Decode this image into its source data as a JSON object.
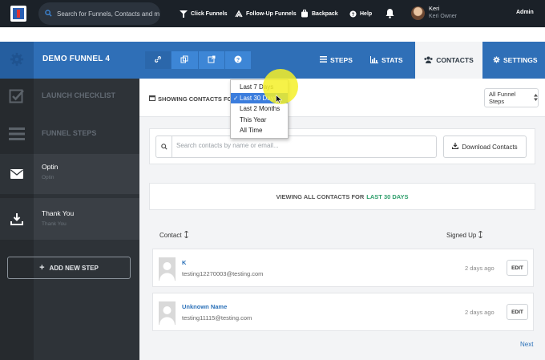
{
  "topnav": {
    "search_placeholder": "Search for Funnels, Contacts and more",
    "items": [
      {
        "label": "Click Funnels",
        "icon": "funnel-icon"
      },
      {
        "label": "Follow-Up Funnels",
        "icon": "follow-up-icon"
      },
      {
        "label": "Backpack",
        "icon": "backpack-icon"
      },
      {
        "label": "Help",
        "icon": "help-icon"
      }
    ],
    "notification_icon": "bell-icon",
    "user": {
      "name": "Keri",
      "role": "Keri  Owner"
    },
    "admin_label": "Admin"
  },
  "funnel": {
    "title": "DEMO FUNNEL 4",
    "tools": [
      "link-icon",
      "copy-icon",
      "external-link-icon",
      "help-icon"
    ],
    "tabs": [
      {
        "label": "STEPS",
        "icon": "list-icon"
      },
      {
        "label": "STATS",
        "icon": "bar-chart-icon"
      },
      {
        "label": "CONTACTS",
        "icon": "users-icon",
        "active": true
      },
      {
        "label": "SETTINGS",
        "icon": "gear-icon"
      }
    ]
  },
  "sidebar": {
    "launch_checklist": "LAUNCH CHECKLIST",
    "funnel_steps": "FUNNEL STEPS",
    "steps": [
      {
        "title": "Optin",
        "subtitle": "Optin",
        "icon": "envelope-icon"
      },
      {
        "title": "Thank You",
        "subtitle": "Thank You",
        "icon": "download-icon"
      }
    ],
    "add_step": "ADD NEW STEP"
  },
  "contacts": {
    "showing_label": "SHOWING CONTACTS FOR",
    "date_options": [
      "Last 7 Days",
      "Last 30 Days",
      "Last 2 Months",
      "This Year",
      "All Time"
    ],
    "selected_date": "Last 30 Days",
    "steps_filter": "All Funnel Steps",
    "search_placeholder": "Search contacts by name or email...",
    "download_label": "Download Contacts",
    "viewing_prefix": "VIEWING ALL CONTACTS FOR",
    "viewing_range": "LAST 30 DAYS",
    "col_contact": "Contact",
    "col_signed_up": "Signed Up",
    "rows": [
      {
        "name": "K",
        "email": "testing12270003@testing.com",
        "signed_up": "2 days ago",
        "action": "EDIT"
      },
      {
        "name": "Unknown Name",
        "email": "testing11115@testing.com",
        "signed_up": "2 days ago",
        "action": "EDIT"
      }
    ],
    "next_label": "Next"
  },
  "colors": {
    "topnav_bg": "#1b2128",
    "funnel_bar": "#2f6fb7",
    "sidebar_bg": "#2e3338",
    "link_blue": "#2a70b8",
    "highlight_green": "#2e9e6b",
    "cursor_highlight": "#f5f028"
  }
}
